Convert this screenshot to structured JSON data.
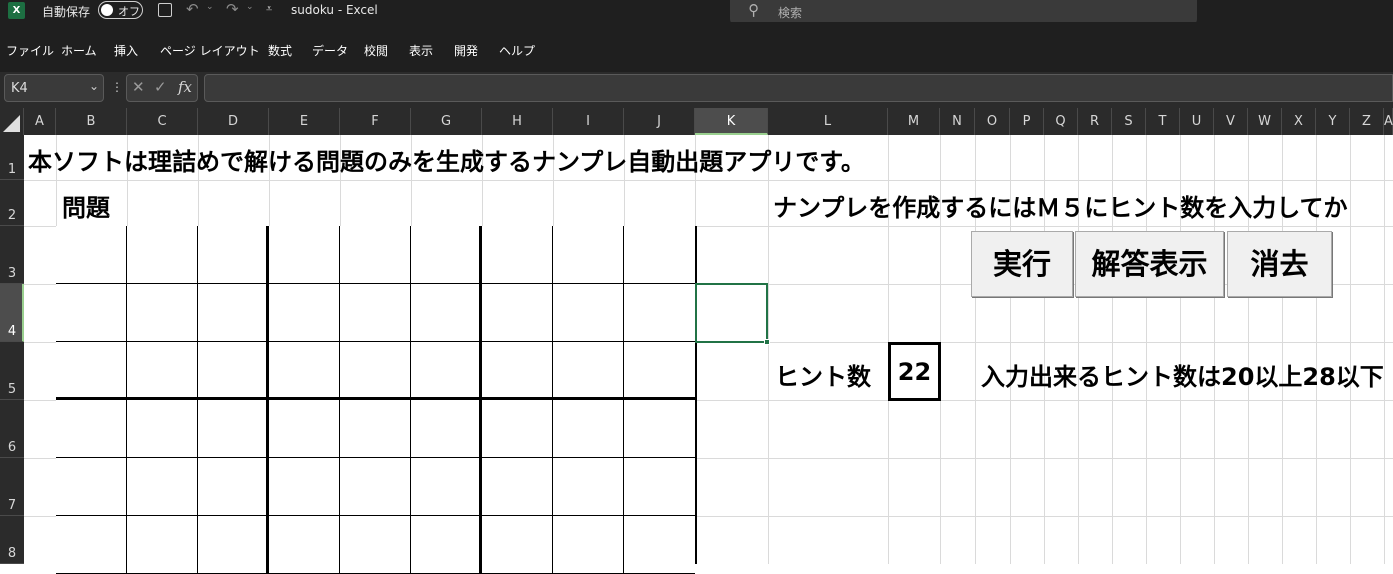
{
  "titlebar": {
    "app_icon": "excel-icon",
    "autosave_label": "自動保存",
    "autosave_toggle": "オフ",
    "doc_title": "sudoku  -  Excel",
    "search_placeholder": "検索"
  },
  "menu": [
    "ファイル",
    "ホーム",
    "挿入",
    "ページ レイアウト",
    "数式",
    "データ",
    "校閲",
    "表示",
    "開発",
    "ヘルプ"
  ],
  "formula_bar": {
    "name_box": "K4",
    "fx_label": "fx",
    "cancel_symbol": "✕",
    "confirm_symbol": "✓",
    "content": ""
  },
  "columns": [
    "A",
    "B",
    "C",
    "D",
    "E",
    "F",
    "G",
    "H",
    "I",
    "J",
    "K",
    "L",
    "M",
    "N",
    "O",
    "P",
    "Q",
    "R",
    "S",
    "T",
    "U",
    "V",
    "W",
    "X",
    "Y",
    "Z",
    "A"
  ],
  "rows": [
    "1",
    "2",
    "3",
    "4",
    "5",
    "6",
    "7",
    "8"
  ],
  "selected_cell": {
    "column": "K",
    "row": "4"
  },
  "sheet": {
    "intro_text": "本ソフトは理詰めで解ける問題のみを生成するナンプレ自動出題アプリです。",
    "problem_label": "問題",
    "instruction_text": "ナンプレを作成するにはＭ５にヒント数を入力してか",
    "buttons": {
      "run": "実行",
      "show_answer": "解答表示",
      "clear": "消去"
    },
    "hint_label": "ヒント数",
    "hint_value": "22",
    "hint_range_text": "入力出来るヒント数は20以上28以下"
  }
}
